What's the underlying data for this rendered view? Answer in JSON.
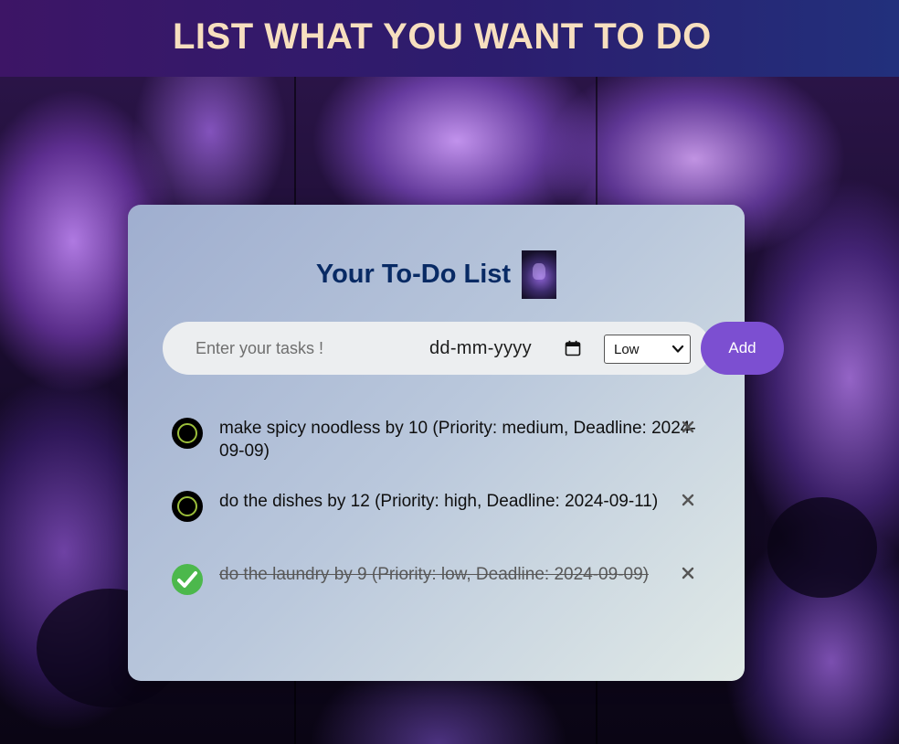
{
  "header": {
    "title": "LIST WHAT YOU WANT TO DO"
  },
  "card": {
    "title": "Your To-Do List",
    "task_input": {
      "placeholder": "Enter your tasks !",
      "value": ""
    },
    "date_input": {
      "display": "dd-mm-yyyy"
    },
    "priority_select": {
      "selected": "Low"
    },
    "add_label": "Add"
  },
  "tasks": [
    {
      "text": "make spicy noodless by 10 (Priority: medium, Deadline: 2024-09-09)",
      "completed": false
    },
    {
      "text": "do the dishes by 12 (Priority: high, Deadline: 2024-09-11)",
      "completed": false
    },
    {
      "text": "do the laundry by 9 (Priority: low, Deadline: 2024-09-09)",
      "completed": true
    }
  ],
  "icons": {
    "calendar": "calendar-icon",
    "chevron": "chevron-down-icon",
    "delete": "close-icon",
    "done": "check-icon",
    "pending": "circle-icon"
  },
  "colors": {
    "header_text": "#f7dfbf",
    "card_title": "#082a64",
    "add_button": "#7c4fd1",
    "done_check": "#4cb84c",
    "pending_ring": "#9bbe3a"
  }
}
